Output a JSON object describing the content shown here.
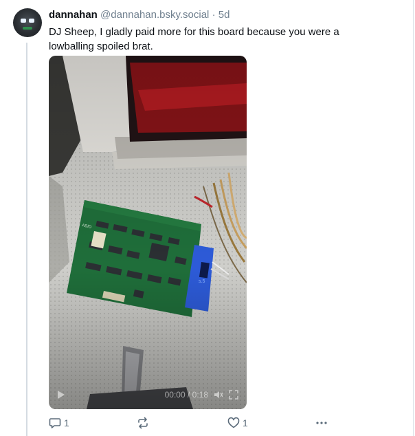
{
  "post": {
    "author_display_name": "dannahan",
    "author_handle": "@dannahan.bsky.social",
    "separator": "·",
    "time_ago": "5d",
    "text": "DJ Sheep, I gladly paid more for this board because you were a lowballing spoiled brat.",
    "media": {
      "type": "video",
      "time_display": "00:00 / 0:18"
    },
    "actions": {
      "reply_count": "1",
      "repost_count": "",
      "like_count": "1"
    }
  },
  "icons": {
    "reply": "speech-bubble-icon",
    "repost": "repost-arrows-icon",
    "like": "heart-icon",
    "more": "ellipsis-icon",
    "play": "play-icon",
    "volume": "volume-icon",
    "fullscreen": "fullscreen-icon"
  },
  "colors": {
    "text": "#0b0f14",
    "muted": "#6f7f8e",
    "action": "#5b6b7a",
    "thread_line": "#d4dbe2",
    "pcb_green": "#1f6e3a",
    "adapter_blue": "#2d5bd8"
  }
}
